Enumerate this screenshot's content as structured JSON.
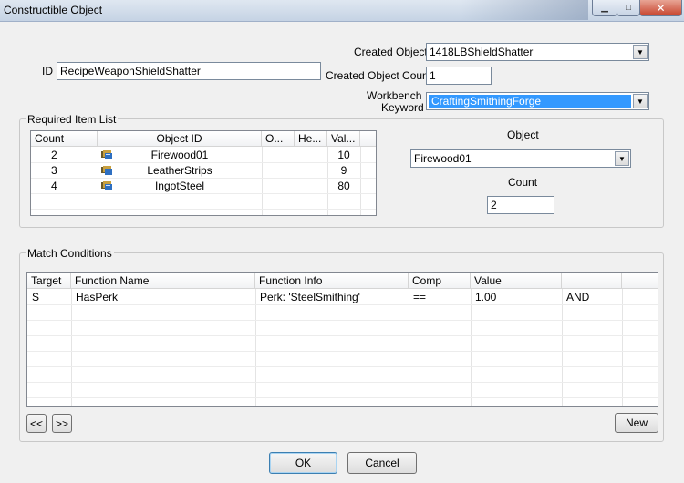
{
  "window": {
    "title": "Constructible Object",
    "minimize_glyph": "▁",
    "maximize_glyph": "□",
    "close_glyph": "✕"
  },
  "form": {
    "id_label": "ID",
    "id_value": "RecipeWeaponShieldShatter",
    "created_object_label": "Created Object",
    "created_object_value": "1418LBShieldShatter",
    "created_object_count_label": "Created Object Count",
    "created_object_count_value": "1",
    "workbench_label_line1": "Workbench",
    "workbench_label_line2": "Keyword",
    "workbench_value": "CraftingSmithingForge"
  },
  "required_items": {
    "group_title": "Required Item List",
    "columns": [
      "Count",
      "Object ID",
      "O...",
      "He...",
      "Val..."
    ],
    "rows": [
      {
        "count": "2",
        "object_id": "Firewood01",
        "o": "",
        "he": "",
        "val": "10"
      },
      {
        "count": "3",
        "object_id": "LeatherStrips",
        "o": "",
        "he": "",
        "val": "9"
      },
      {
        "count": "4",
        "object_id": "IngotSteel",
        "o": "",
        "he": "",
        "val": "80"
      }
    ],
    "object_label": "Object",
    "object_value": "Firewood01",
    "count_label": "Count",
    "count_value": "2"
  },
  "match_conditions": {
    "group_title": "Match Conditions",
    "columns": [
      "Target",
      "Function Name",
      "Function Info",
      "Comp",
      "Value",
      ""
    ],
    "rows": [
      {
        "target": "S",
        "function_name": "HasPerk",
        "function_info": "Perk: 'SteelSmithing'",
        "comp": "==",
        "value": "1.00",
        "op": "AND"
      }
    ],
    "prev_label": "<<",
    "next_label": ">>",
    "new_label": "New"
  },
  "footer": {
    "ok_label": "OK",
    "cancel_label": "Cancel"
  },
  "icons": {
    "combo_arrow": "▼",
    "item_icon": "book-icon"
  }
}
